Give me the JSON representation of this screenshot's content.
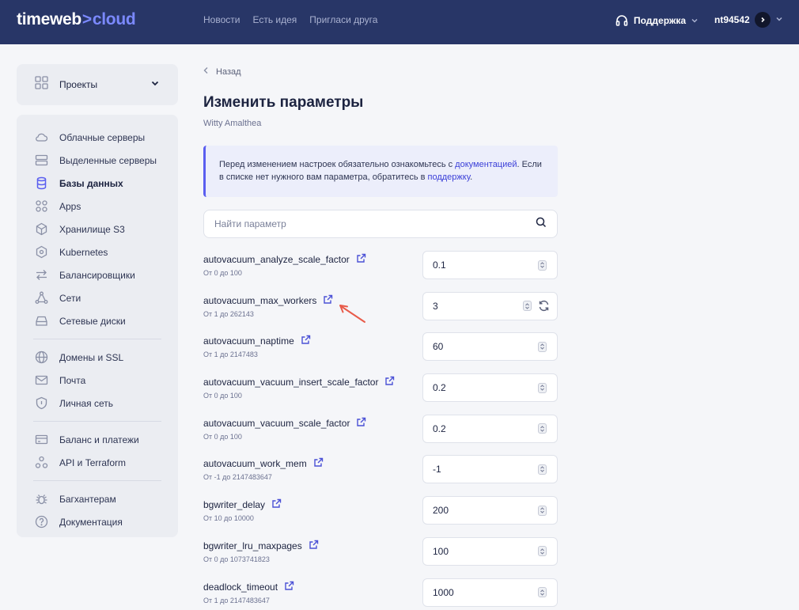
{
  "header": {
    "logo_main": "timeweb",
    "logo_sep": ">",
    "logo_accent": "cloud",
    "nav": [
      {
        "label": "Новости"
      },
      {
        "label": "Есть идея"
      },
      {
        "label": "Пригласи друга"
      }
    ],
    "support_label": "Поддержка",
    "username": "nt94542"
  },
  "sidebar": {
    "projects_label": "Проекты",
    "groups": [
      [
        {
          "label": "Облачные серверы",
          "icon": "cloud-icon"
        },
        {
          "label": "Выделенные серверы",
          "icon": "server-icon"
        },
        {
          "label": "Базы данных",
          "icon": "database-icon",
          "active": true
        },
        {
          "label": "Apps",
          "icon": "apps-icon"
        },
        {
          "label": "Хранилище S3",
          "icon": "box-icon"
        },
        {
          "label": "Kubernetes",
          "icon": "kubernetes-icon"
        },
        {
          "label": "Балансировщики",
          "icon": "balancer-icon"
        },
        {
          "label": "Сети",
          "icon": "network-icon"
        },
        {
          "label": "Сетевые диски",
          "icon": "disk-icon"
        }
      ],
      [
        {
          "label": "Домены и SSL",
          "icon": "globe-icon"
        },
        {
          "label": "Почта",
          "icon": "mail-icon"
        },
        {
          "label": "Личная сеть",
          "icon": "shield-icon"
        }
      ],
      [
        {
          "label": "Баланс и платежи",
          "icon": "wallet-icon"
        },
        {
          "label": "API и Terraform",
          "icon": "api-icon"
        }
      ],
      [
        {
          "label": "Багхантерам",
          "icon": "bug-icon"
        },
        {
          "label": "Документация",
          "icon": "help-icon"
        }
      ]
    ]
  },
  "main": {
    "back_label": "Назад",
    "title": "Изменить параметры",
    "subtitle": "Witty Amalthea",
    "note": {
      "part1": "Перед изменением настроек обязательно ознакомьтесь с ",
      "link1": "документацией",
      "part2": ". Если в списке нет нужного вам параметра, обратитесь в ",
      "link2": "поддержку",
      "part3": "."
    },
    "search_placeholder": "Найти параметр",
    "params": [
      {
        "name": "autovacuum_analyze_scale_factor",
        "range": "От 0 до 100",
        "value": "0.1"
      },
      {
        "name": "autovacuum_max_workers",
        "range": "От 1 до 262143",
        "value": "3",
        "modified": true
      },
      {
        "name": "autovacuum_naptime",
        "range": "От 1 до 2147483",
        "value": "60"
      },
      {
        "name": "autovacuum_vacuum_insert_scale_factor",
        "range": "От 0 до 100",
        "value": "0.2"
      },
      {
        "name": "autovacuum_vacuum_scale_factor",
        "range": "От 0 до 100",
        "value": "0.2"
      },
      {
        "name": "autovacuum_work_mem",
        "range": "От -1 до 2147483647",
        "value": "-1"
      },
      {
        "name": "bgwriter_delay",
        "range": "От 10 до 10000",
        "value": "200"
      },
      {
        "name": "bgwriter_lru_maxpages",
        "range": "От 0 до 1073741823",
        "value": "100"
      },
      {
        "name": "deadlock_timeout",
        "range": "От 1 до 2147483647",
        "value": "1000"
      }
    ]
  },
  "colors": {
    "header_bg": "#283667",
    "accent": "#5a5ef0",
    "annotation_arrow": "#e85b4a"
  }
}
